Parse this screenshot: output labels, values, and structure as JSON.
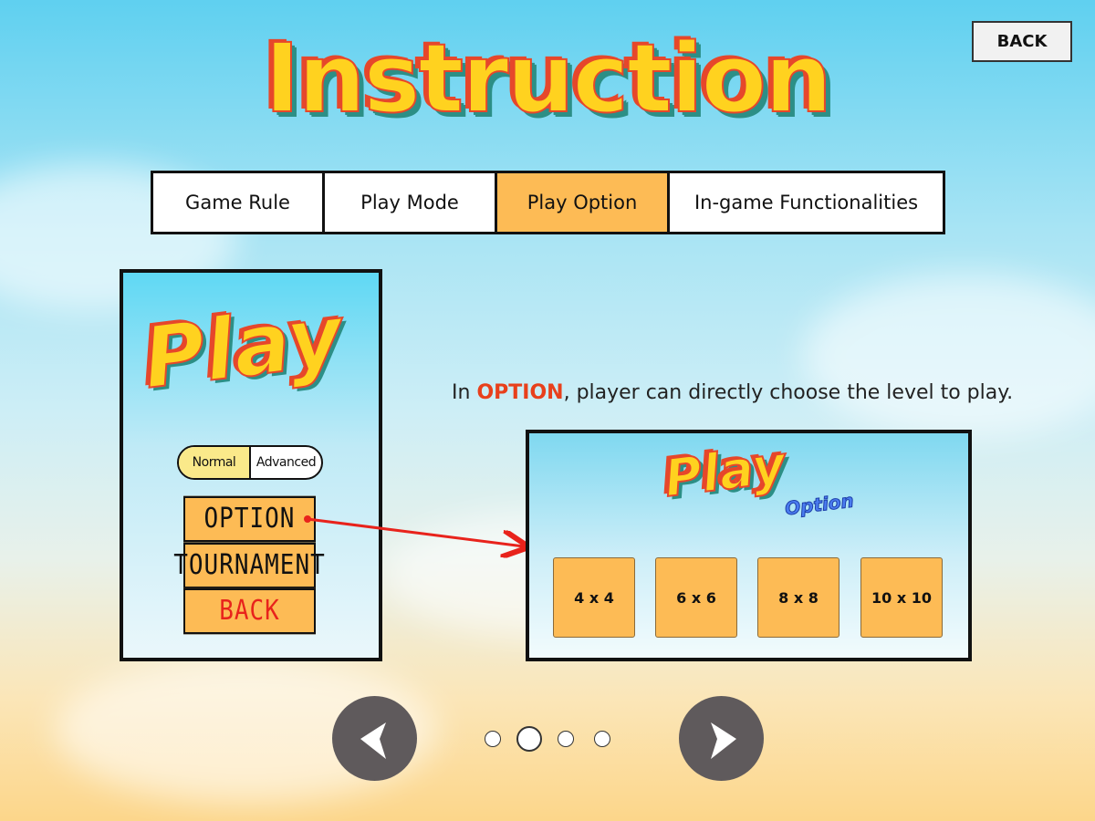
{
  "header": {
    "title": "Instruction",
    "back_label": "BACK"
  },
  "tabs": [
    {
      "label": "Game Rule",
      "active": false
    },
    {
      "label": "Play Mode",
      "active": false
    },
    {
      "label": "Play Option",
      "active": true
    },
    {
      "label": "In-game Functionalities",
      "active": false
    }
  ],
  "preview_screen": {
    "logo": "Play",
    "mode_toggle": {
      "options": [
        "Normal",
        "Advanced"
      ],
      "selected": "Normal"
    },
    "menu_buttons": [
      "OPTION",
      "TOURNAMENT",
      "BACK"
    ]
  },
  "description": {
    "prefix": "In ",
    "highlight": "OPTION",
    "suffix": ", player can directly choose the level to play."
  },
  "option_screen": {
    "logo": "Play",
    "subtitle": "Option",
    "levels": [
      "4 x 4",
      "6 x 6",
      "8 x 8",
      "10 x 10"
    ]
  },
  "pagination": {
    "total_pages": 4,
    "current_page": 2
  },
  "colors": {
    "active_tab": "#fdbb55",
    "highlight_text": "#e8401c",
    "title_fill": "#ffd21f",
    "title_outline": "#e6472b",
    "title_shadow": "#2c8f86",
    "nav_button": "#5f5a5c",
    "arrow": "#e8231c"
  },
  "icons": {
    "prev": "triangle-left-icon",
    "next": "triangle-right-icon"
  }
}
